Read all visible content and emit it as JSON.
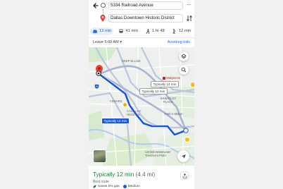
{
  "header": {
    "origin": "5334 Railroad Avenue",
    "destination": "Dallas Downtown Historic District"
  },
  "modes": [
    {
      "icon": "car-icon",
      "label": "12 min",
      "selected": true
    },
    {
      "icon": "transit-icon",
      "label": "41 min",
      "selected": false
    },
    {
      "icon": "walk-icon",
      "label": "1 hr 48",
      "selected": false
    },
    {
      "icon": "ride-icon",
      "label": "12 min",
      "selected": false
    },
    {
      "icon": "bike-icon",
      "label": "28",
      "selected": false
    }
  ],
  "options": {
    "leave": "Leave 5:00 AM",
    "avoid": "Avoiding tolls"
  },
  "map": {
    "labels": {
      "deep_ellum": "DEEP ELLUM",
      "walgreens": "Walgreens",
      "wheatley": "WHEATLEY PLACE",
      "cadillac": "CADILLAC HEIGHTS",
      "park_manor": "Park-n-Manor",
      "cedars": "CEDARS",
      "central": "Central Wastewater Treatment Plant"
    },
    "callouts": {
      "alt_1": "Typically 14 min",
      "alt_2": "Typically 12 min",
      "main": "Typically 12 min"
    },
    "highway_45": "45",
    "colors": {
      "route": "#1a56db",
      "alt_route": "#a7b4d6",
      "destination_pin": "#ea4335"
    }
  },
  "sheet": {
    "eta": "Typically 12 min",
    "distance": "(4.4 mi)",
    "best": "Best route",
    "eco": "Saves 5% gas",
    "traffic": "Medium"
  }
}
